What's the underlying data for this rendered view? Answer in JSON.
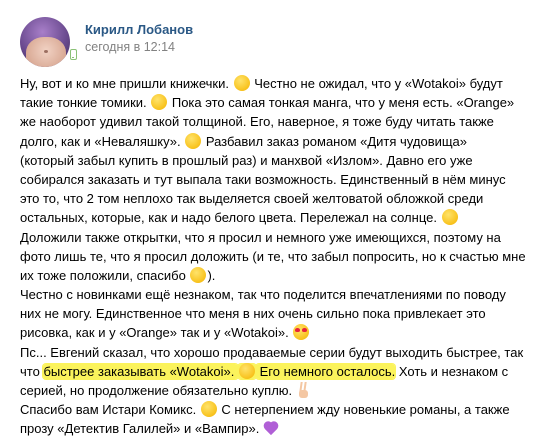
{
  "post": {
    "author": "Кирилл Лобанов",
    "date": "сегодня в 12:14",
    "lines": [
      {
        "parts": [
          "Ну, вот и ко мне пришли книжечки. ",
          "grinning-smiley",
          " Честно не ожидал, что у «Wotakoi» будут"
        ]
      },
      {
        "parts": [
          "такие тонкие томики. ",
          "flushed-smiley",
          " Пока это самая тонкая манга, что у меня есть. «Orange»"
        ]
      },
      {
        "parts": [
          "же наоборот удивил такой толщиной. Его, наверное, я тоже буду читать также"
        ]
      },
      {
        "parts": [
          "долго, как и «Неваляшку». ",
          "smiling-smiley",
          " Разбавил заказ романом «Дитя чудовища»"
        ]
      },
      {
        "parts": [
          "(который забыл купить в прошлый раз) и манхвой «Излом». Давно его уже"
        ]
      },
      {
        "parts": [
          "собирался заказать и тут выпала таки возможность. Единственный в нём минус"
        ]
      },
      {
        "parts": [
          "это то, что 2 том неплохо так выделяется своей желтоватой обложкой среди"
        ]
      },
      {
        "parts": [
          "остальных, которые, как и надо белого цвета. Перележал на солнце. ",
          "laughing-smiley"
        ]
      },
      {
        "parts": [
          "Доложили также открытки, что я просил и немного уже имеющихся, поэтому на"
        ]
      },
      {
        "parts": [
          "фото лишь те, что я просил доложить (и те, что забыл попросить, но к счастью мне"
        ]
      },
      {
        "parts": [
          "их тоже положили, спасибо ",
          "smiling-smiley",
          ")."
        ]
      },
      {
        "parts": [
          "Честно с новинками ещё незнаком, так что поделится впечатлениями по поводу"
        ]
      },
      {
        "parts": [
          "них не могу. Единственное что меня в них очень сильно пока привлекает это"
        ]
      },
      {
        "parts": [
          "рисовка, как и у «Orange» так и у «Wotakoi». ",
          "heart-eyes-smiley"
        ]
      },
      {
        "parts": [
          "Пс... Евгений сказал, что хорошо продаваемые серии будут выходить быстрее, так"
        ]
      },
      {
        "parts": [
          "что ",
          "HL:быстрее заказывать «Wotakoi». ",
          "flushed-smiley-hl",
          "HL: Его немного осталось.",
          " Хоть и незнаком с"
        ]
      },
      {
        "parts": [
          "серией, но продолжение обязательно куплю. ",
          "victory-hand"
        ]
      },
      {
        "parts": [
          "Спасибо вам Истари Комикс. ",
          "smiling-smiley",
          " С нетерпением жду новенькие романы, а также"
        ]
      },
      {
        "parts": [
          "прозу «Детектив Галилей» и «Вампир». ",
          "purple-heart"
        ]
      }
    ]
  },
  "colors": {
    "author": "#2a5885",
    "date": "#828282",
    "highlight": "#fbf35c",
    "online_mobile": "#8ac176"
  }
}
